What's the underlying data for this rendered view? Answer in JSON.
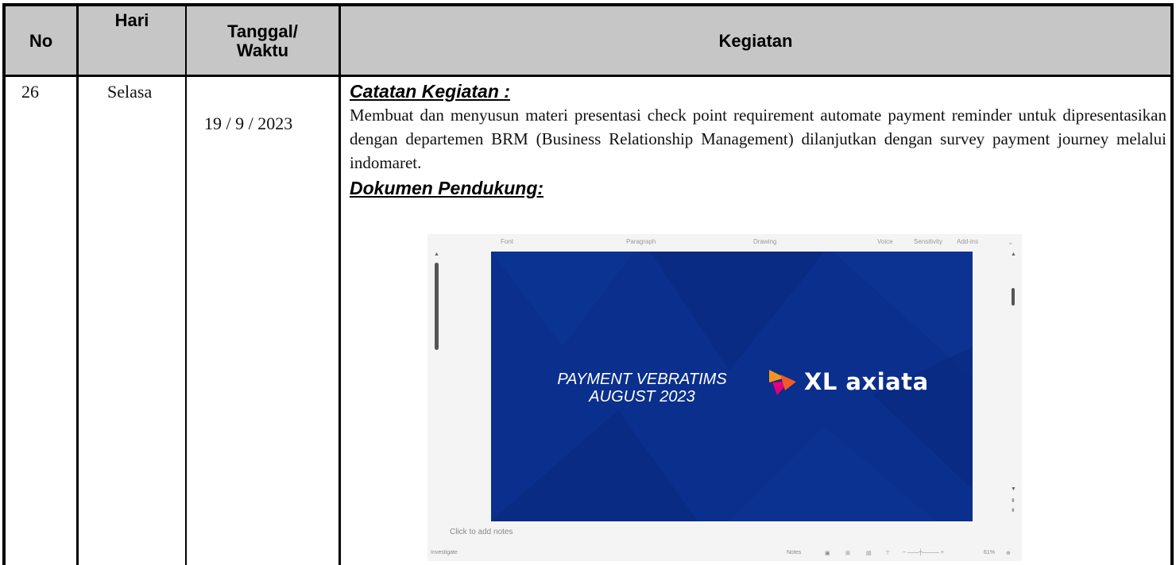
{
  "header": {
    "no": "No",
    "hari": "Hari",
    "tanggal": "Tanggal/",
    "waktu": "Waktu",
    "kegiatan": "Kegiatan"
  },
  "row": {
    "no": "26",
    "hari": "Selasa",
    "tanggal": "19 / 9 / 2023",
    "catatan_heading": "Catatan Kegiatan :",
    "catatan_text": "Membuat dan menyusun materi presentasi check point requirement automate payment reminder untuk dipresentasikan dengan departemen BRM (Business Relationship Management) dilanjutkan dengan survey payment journey melalui indomaret.",
    "dokumen_heading": "Dokumen Pendukung:"
  },
  "screenshot": {
    "ribbon": [
      "Font",
      "Paragraph",
      "Drawing",
      "Voice",
      "Sensitivity",
      "Add-ins"
    ],
    "slide_title_line1": "PAYMENT VEBRATIMS",
    "slide_title_line2": "AUGUST 2023",
    "logo_text": "XL axiata",
    "notes_placeholder": "Click to add notes",
    "status_left": "Investigate",
    "status_notes": "Notes",
    "zoom": "61%",
    "colors": {
      "slide_bg": "#0a2f8c",
      "logo_orange": "#f7941d",
      "logo_pink": "#e2007a"
    }
  }
}
